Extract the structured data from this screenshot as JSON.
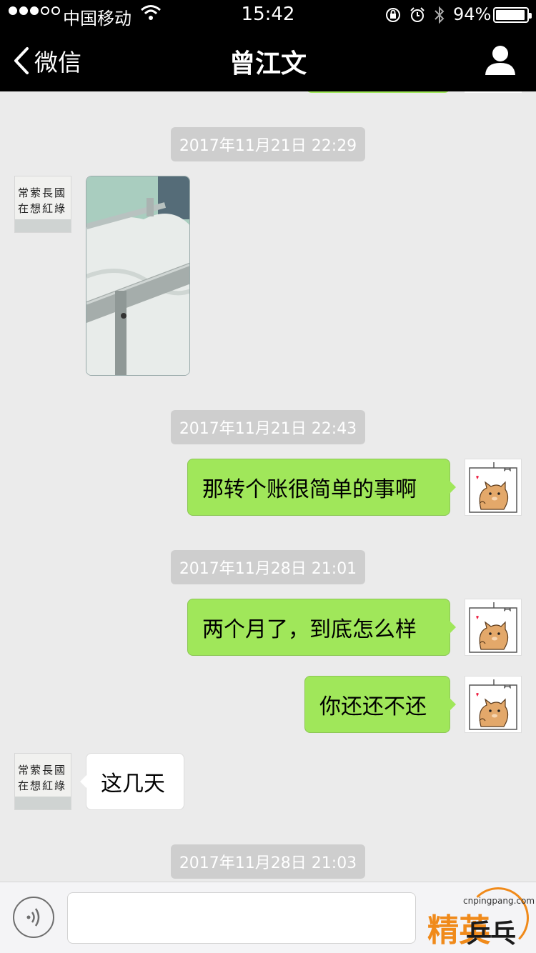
{
  "status_bar": {
    "carrier": "中国移动",
    "time": "15:42",
    "battery": "94%"
  },
  "nav": {
    "back_label": "微信",
    "title": "曾江文"
  },
  "contact_avatar_text": {
    "row1": "常萦長國",
    "row2": "在想紅綠"
  },
  "messages": {
    "ts1": "2017年11月21日 22:29",
    "ts2": "2017年11月21日 22:43",
    "m1": "那转个账很简单的事啊",
    "ts3": "2017年11月28日 21:01",
    "m2": "两个月了，到底怎么样",
    "m3": "你还还不还",
    "m4": "这几天",
    "ts4": "2017年11月28日 21:03"
  },
  "input": {
    "placeholder": ""
  },
  "watermark": {
    "url": "cnpingpang.com",
    "word1": "精英",
    "word2": "乒乓网"
  },
  "colors": {
    "sent_bubble": "#a0e75a",
    "chat_bg": "#ebebeb",
    "nav_bg": "#000000"
  }
}
